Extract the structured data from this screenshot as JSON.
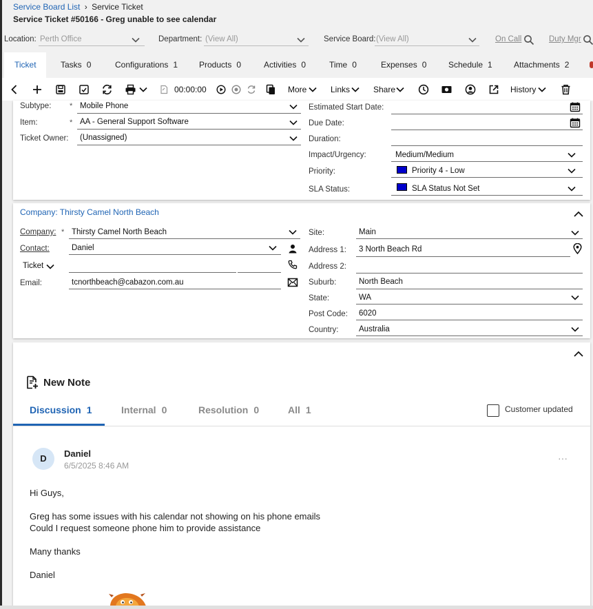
{
  "breadcrumb": {
    "parent": "Service Board List",
    "current": "Service Ticket"
  },
  "ticket_title": "Service Ticket #50166 - Greg unable to see calendar",
  "filters": {
    "location_label": "Location:",
    "location_value": "Perth Office",
    "department_label": "Department:",
    "department_value": "(View All)",
    "board_label": "Service Board:",
    "board_value": "(View All)",
    "on_call": "On Call",
    "duty_mgr": "Duty Mgr"
  },
  "tabs": [
    {
      "label": "Ticket",
      "count": ""
    },
    {
      "label": "Tasks",
      "count": "0"
    },
    {
      "label": "Configurations",
      "count": "1"
    },
    {
      "label": "Products",
      "count": "0"
    },
    {
      "label": "Activities",
      "count": "0"
    },
    {
      "label": "Time",
      "count": "0"
    },
    {
      "label": "Expenses",
      "count": "0"
    },
    {
      "label": "Schedule",
      "count": "1"
    },
    {
      "label": "Attachments",
      "count": "2"
    }
  ],
  "toolbar": {
    "timer": "00:00:00",
    "more": "More",
    "links": "Links",
    "share": "Share",
    "history": "History"
  },
  "ticket_form": {
    "subtype_label": "Subtype:",
    "subtype_value": "Mobile Phone",
    "item_label": "Item:",
    "item_value": "AA - General Support Software",
    "owner_label": "Ticket Owner:",
    "owner_value": "(Unassigned)",
    "est_start_label": "Estimated Start Date:",
    "due_label": "Due Date:",
    "duration_label": "Duration:",
    "impact_label": "Impact/Urgency:",
    "impact_value": "Medium/Medium",
    "priority_label": "Priority:",
    "priority_value": "Priority 4 - Low",
    "sla_label": "SLA Status:",
    "sla_value": "SLA Status Not Set",
    "required_mark": "*",
    "priority_color": "#0000cc",
    "sla_color": "#0000cc"
  },
  "company": {
    "header": "Company: Thirsty Camel North Beach",
    "company_label": "Company:",
    "company_value": "Thirsty Camel North Beach",
    "contact_label": "Contact:",
    "contact_value": "Daniel",
    "phone_type": "Ticket",
    "email_label": "Email:",
    "email_value": "tcnorthbeach@cabazon.com.au",
    "site_label": "Site:",
    "site_value": "Main",
    "address1_label": "Address 1:",
    "address1_value": "3 North Beach Rd",
    "address2_label": "Address 2:",
    "suburb_label": "Suburb:",
    "suburb_value": "North Beach",
    "state_label": "State:",
    "state_value": "WA",
    "postcode_label": "Post Code:",
    "postcode_value": "6020",
    "country_label": "Country:",
    "country_value": "Australia",
    "link_color": "#1f64b4"
  },
  "notes": {
    "new_note": "New Note",
    "tabs": [
      {
        "label": "Discussion",
        "count": "1"
      },
      {
        "label": "Internal",
        "count": "0"
      },
      {
        "label": "Resolution",
        "count": "0"
      },
      {
        "label": "All",
        "count": "1"
      }
    ],
    "customer_updated": "Customer updated",
    "active_color": "#1f64b4"
  },
  "note": {
    "avatar_initial": "D",
    "author": "Daniel",
    "timestamp": "6/5/2025 8:46 AM",
    "menu": "···",
    "lines": [
      "Hi Guys,",
      "Greg has some issues with his calendar not showing on his phone emails",
      "Could I request someone phone him to provide assistance",
      "Many thanks",
      "Daniel"
    ]
  }
}
